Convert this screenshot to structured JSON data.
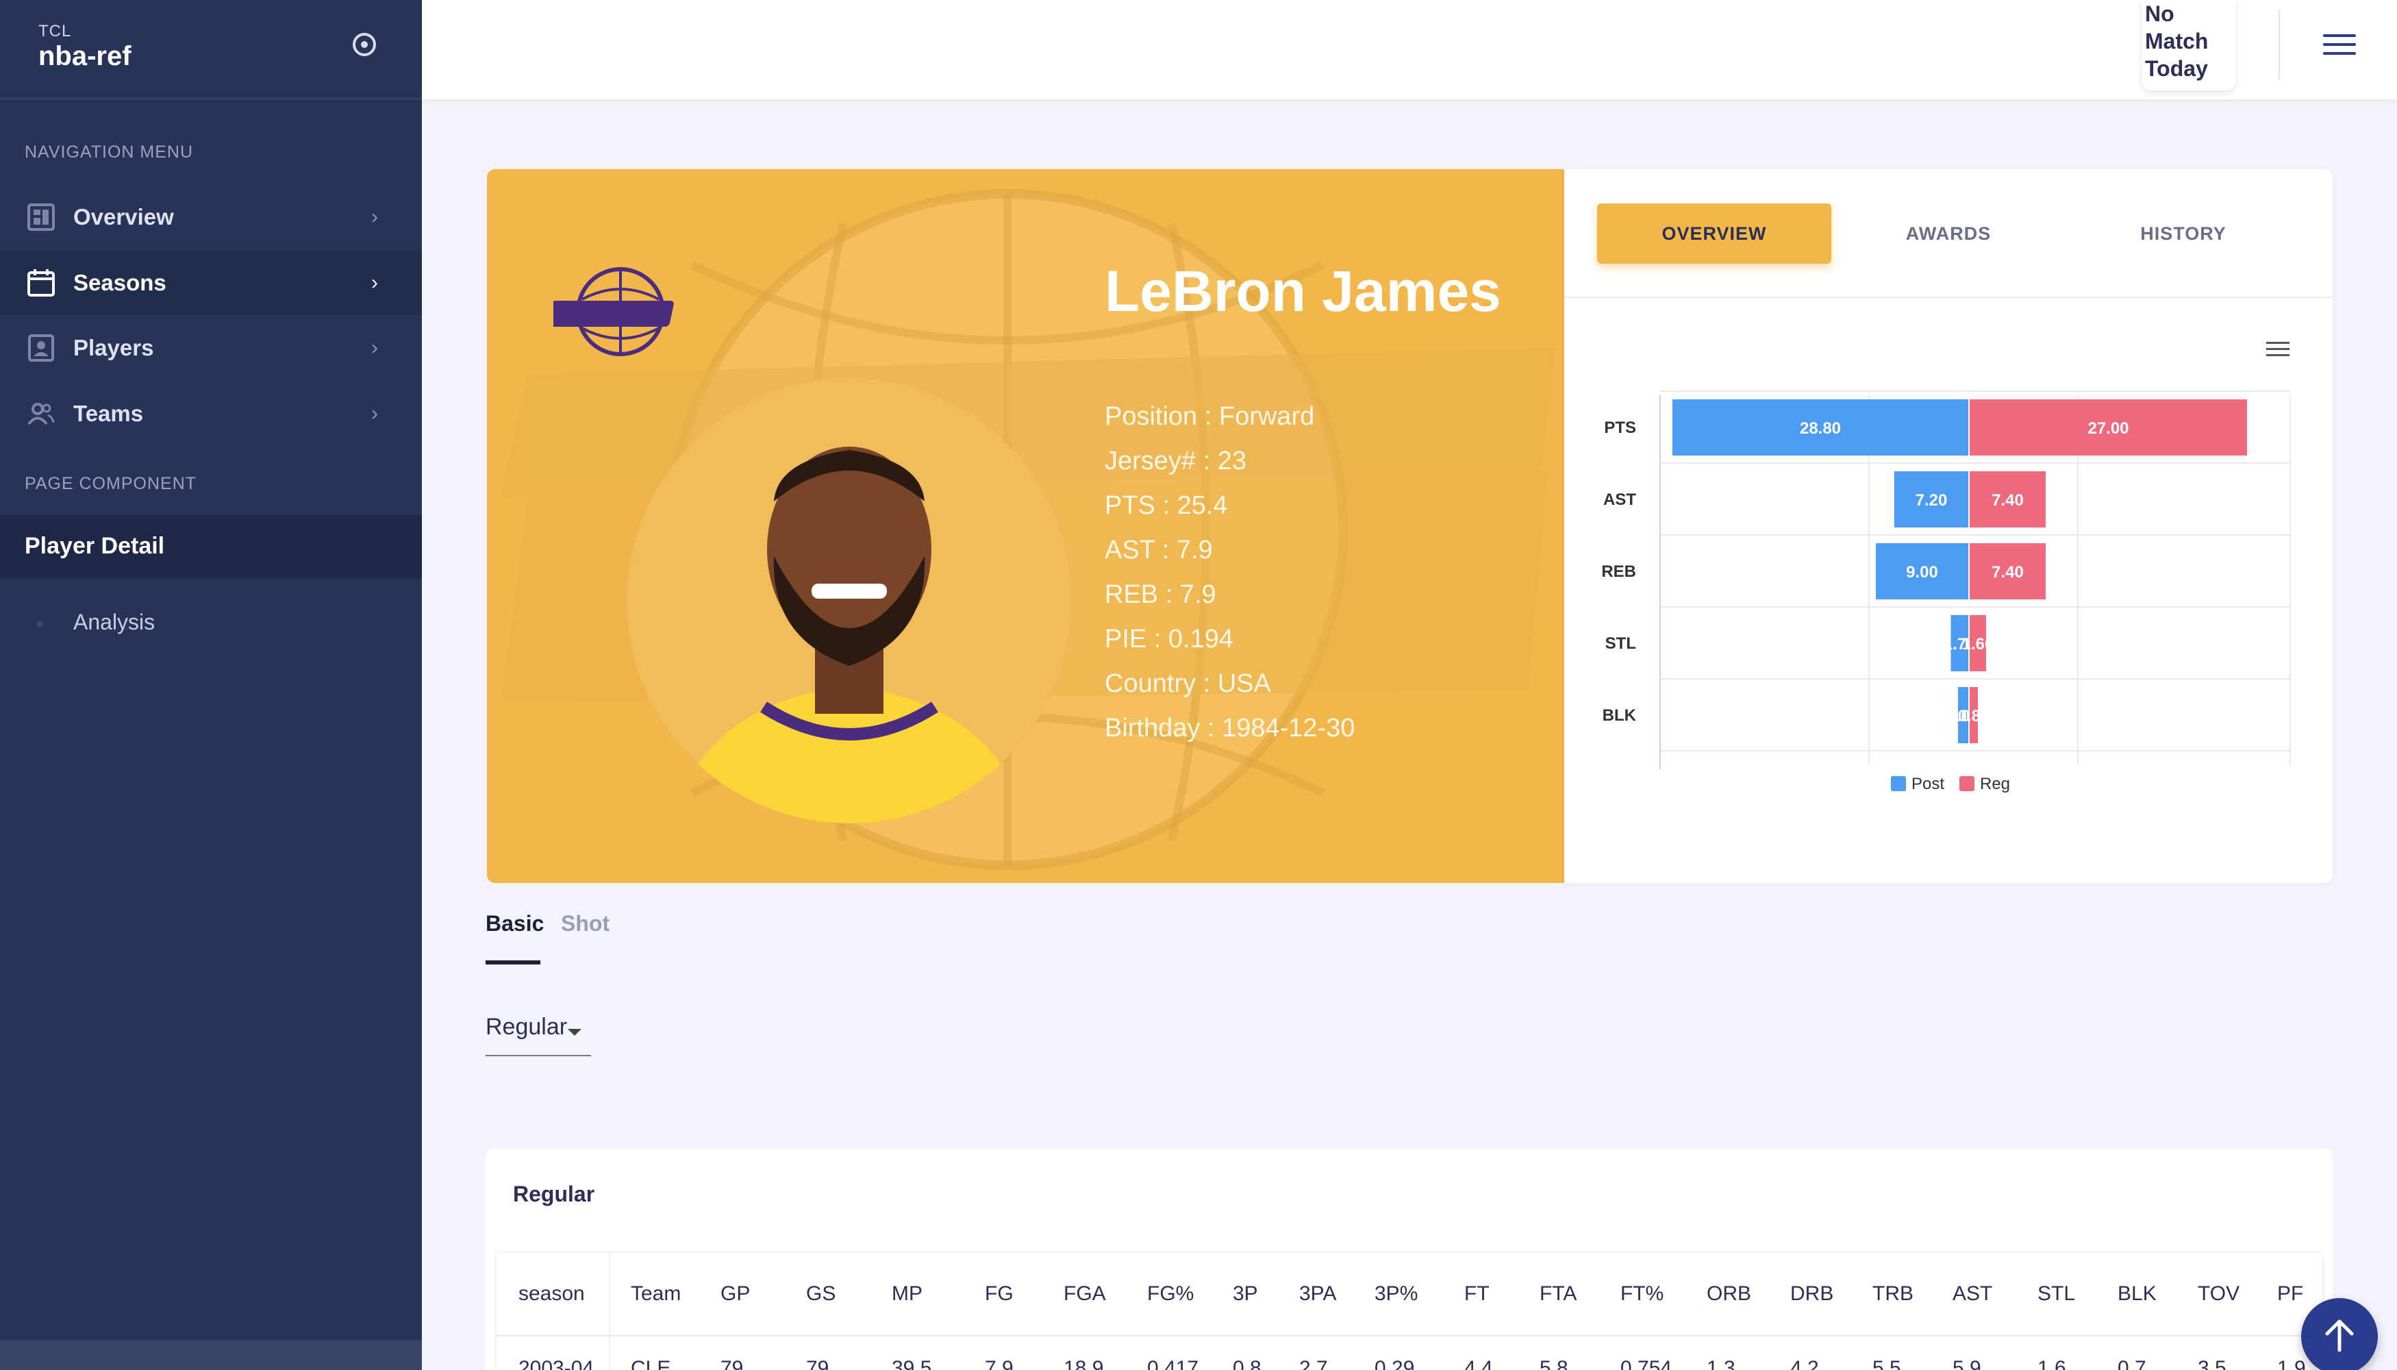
{
  "app": {
    "small_title": "TCL",
    "title": "nba-ref"
  },
  "sidebar": {
    "section_nav": "NAVIGATION MENU",
    "items": [
      {
        "label": "Overview"
      },
      {
        "label": "Seasons"
      },
      {
        "label": "Players"
      },
      {
        "label": "Teams"
      }
    ],
    "section_page": "PAGE COMPONENT",
    "page_title": "Player Detail",
    "page_items": [
      {
        "label": "Analysis"
      }
    ]
  },
  "topbar": {
    "match_lines": [
      "No",
      "Match",
      "Today"
    ]
  },
  "player": {
    "name": "LeBron James",
    "info": [
      "Position : Forward",
      "Jersey# : 23",
      "PTS :  25.4",
      "AST :  7.9",
      "REB :  7.9",
      "PIE :  0.194",
      "Country :  USA",
      "Birthday :  1984-12-30"
    ]
  },
  "tabs": [
    {
      "label": "OVERVIEW"
    },
    {
      "label": "AWARDS"
    },
    {
      "label": "HISTORY"
    }
  ],
  "chart_data": {
    "type": "bar",
    "orientation": "horizontal-diverging",
    "categories": [
      "PTS",
      "AST",
      "REB",
      "STL",
      "BLK"
    ],
    "series": [
      {
        "name": "Post",
        "values": [
          28.8,
          7.2,
          9.0,
          1.7,
          1.0
        ],
        "color": "#4c9cf3"
      },
      {
        "name": "Reg",
        "values": [
          27.0,
          7.4,
          7.4,
          1.6,
          0.8
        ],
        "color": "#ee6a7c"
      }
    ],
    "value_labels": {
      "Post": [
        "28.80",
        "7.20",
        "9.00",
        "1.70",
        "1.00"
      ],
      "Reg": [
        "27.00",
        "7.40",
        "7.40",
        "1.60",
        "0.80"
      ]
    },
    "grid": true,
    "legend": "bottom"
  },
  "subtabs": {
    "basic": "Basic",
    "shot": "Shot"
  },
  "select": {
    "value": "Regular"
  },
  "table": {
    "title": "Regular",
    "columns": [
      "season",
      "Team",
      "GP",
      "GS",
      "MP",
      "FG",
      "FGA",
      "FG%",
      "3P",
      "3PA",
      "3P%",
      "FT",
      "FTA",
      "FT%",
      "ORB",
      "DRB",
      "TRB",
      "AST",
      "STL",
      "BLK",
      "TOV",
      "PF"
    ],
    "rows": [
      [
        "2003-04",
        "CLE",
        "79",
        "79",
        "39.5",
        "7.9",
        "18.9",
        "0.417",
        "0.8",
        "2.7",
        "0.29",
        "4.4",
        "5.8",
        "0.754",
        "1.3",
        "4.2",
        "5.5",
        "5.9",
        "1.6",
        "0.7",
        "3.5",
        "1.9"
      ]
    ]
  },
  "colors": {
    "accent": "#f3b64b",
    "sidebar": "#283357",
    "primary": "#2b3c8e"
  }
}
